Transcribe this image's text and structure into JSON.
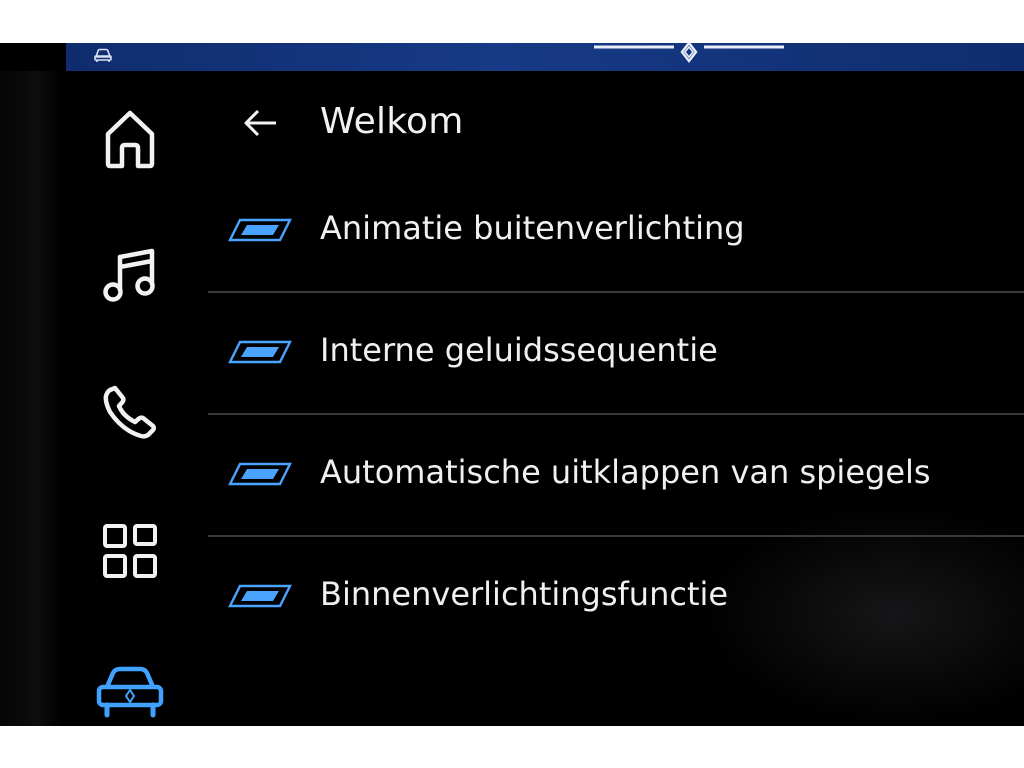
{
  "colors": {
    "accent": "#4aa3ff",
    "text": "#f0f0f0",
    "status_bar": "#173a86",
    "background": "#000000"
  },
  "status_bar": {
    "left_icon": "car-outline-icon",
    "center_icon": "renault-logo-icon"
  },
  "sidebar": {
    "items": [
      {
        "icon": "home-icon",
        "active": false
      },
      {
        "icon": "music-note-icon",
        "active": false
      },
      {
        "icon": "phone-icon",
        "active": false
      },
      {
        "icon": "apps-grid-icon",
        "active": false
      },
      {
        "icon": "car-icon",
        "active": true
      }
    ]
  },
  "header": {
    "back_icon": "arrow-left-icon",
    "title": "Welkom"
  },
  "menu": {
    "items": [
      {
        "label": "Animatie buitenverlichting",
        "icon": "light-parallelogram-icon"
      },
      {
        "label": "Interne geluidssequentie",
        "icon": "light-parallelogram-icon"
      },
      {
        "label": "Automatische uitklappen van spiegels",
        "icon": "light-parallelogram-icon"
      },
      {
        "label": "Binnenverlichtingsfunctie",
        "icon": "light-parallelogram-icon"
      }
    ]
  }
}
